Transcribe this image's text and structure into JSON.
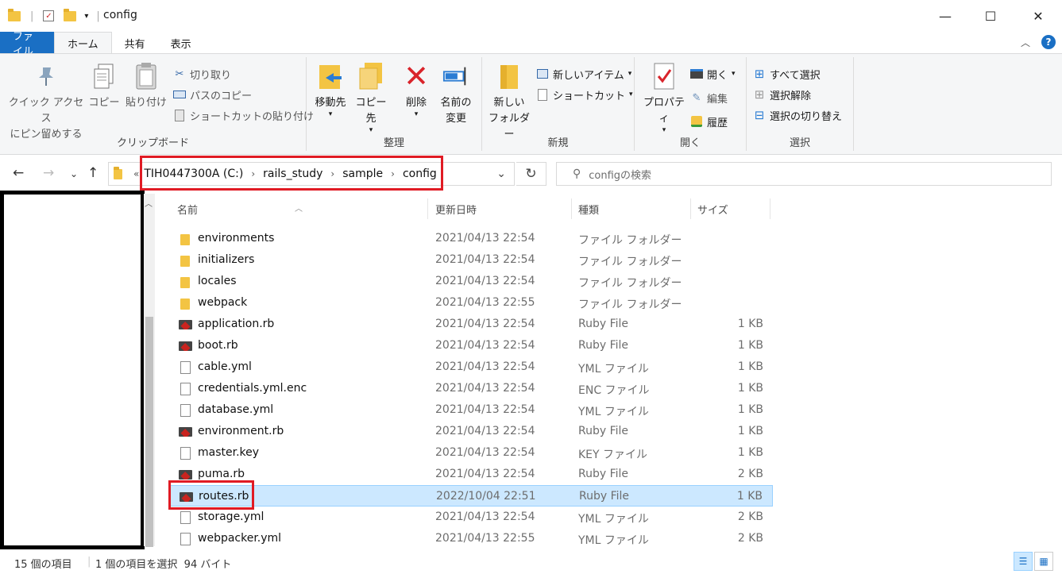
{
  "window": {
    "title": "config",
    "minimize": "—",
    "maximize": "☐",
    "close": "✕"
  },
  "tabs": {
    "file": "ファイル",
    "home": "ホーム",
    "share": "共有",
    "view": "表示"
  },
  "ribbon": {
    "clipboard": {
      "label": "クリップボード",
      "pin_quick_access": [
        "クイック アクセス",
        "にピン留めする"
      ],
      "copy": "コピー",
      "paste": "貼り付け",
      "cut": "切り取り",
      "copy_path": "パスのコピー",
      "paste_shortcut": "ショートカットの貼り付け"
    },
    "organize": {
      "label": "整理",
      "move_to": "移動先",
      "copy_to": "コピー先",
      "delete": "削除",
      "rename": [
        "名前の",
        "変更"
      ]
    },
    "new": {
      "label": "新規",
      "new_folder": [
        "新しい",
        "フォルダー"
      ],
      "new_item": "新しいアイテム",
      "shortcut": "ショートカット"
    },
    "open": {
      "label": "開く",
      "properties": "プロパティ",
      "open": "開く",
      "edit": "編集",
      "history": "履歴"
    },
    "select": {
      "label": "選択",
      "select_all": "すべて選択",
      "select_none": "選択解除",
      "invert": "選択の切り替え"
    }
  },
  "address": {
    "overflow": "«",
    "crumbs": [
      "TIH0447300A (C:)",
      "rails_study",
      "sample",
      "config"
    ],
    "search_placeholder": "configの検索"
  },
  "columns": {
    "name": "名前",
    "date": "更新日時",
    "type": "種類",
    "size": "サイズ"
  },
  "files": [
    {
      "name": "environments",
      "date": "2021/04/13 22:54",
      "type": "ファイル フォルダー",
      "size": "",
      "icon": "folder"
    },
    {
      "name": "initializers",
      "date": "2021/04/13 22:54",
      "type": "ファイル フォルダー",
      "size": "",
      "icon": "folder"
    },
    {
      "name": "locales",
      "date": "2021/04/13 22:54",
      "type": "ファイル フォルダー",
      "size": "",
      "icon": "folder"
    },
    {
      "name": "webpack",
      "date": "2021/04/13 22:55",
      "type": "ファイル フォルダー",
      "size": "",
      "icon": "folder"
    },
    {
      "name": "application.rb",
      "date": "2021/04/13 22:54",
      "type": "Ruby File",
      "size": "1 KB",
      "icon": "ruby"
    },
    {
      "name": "boot.rb",
      "date": "2021/04/13 22:54",
      "type": "Ruby File",
      "size": "1 KB",
      "icon": "ruby"
    },
    {
      "name": "cable.yml",
      "date": "2021/04/13 22:54",
      "type": "YML ファイル",
      "size": "1 KB",
      "icon": "file"
    },
    {
      "name": "credentials.yml.enc",
      "date": "2021/04/13 22:54",
      "type": "ENC ファイル",
      "size": "1 KB",
      "icon": "file"
    },
    {
      "name": "database.yml",
      "date": "2021/04/13 22:54",
      "type": "YML ファイル",
      "size": "1 KB",
      "icon": "file"
    },
    {
      "name": "environment.rb",
      "date": "2021/04/13 22:54",
      "type": "Ruby File",
      "size": "1 KB",
      "icon": "ruby"
    },
    {
      "name": "master.key",
      "date": "2021/04/13 22:54",
      "type": "KEY ファイル",
      "size": "1 KB",
      "icon": "file"
    },
    {
      "name": "puma.rb",
      "date": "2021/04/13 22:54",
      "type": "Ruby File",
      "size": "2 KB",
      "icon": "ruby"
    },
    {
      "name": "routes.rb",
      "date": "2022/10/04 22:51",
      "type": "Ruby File",
      "size": "1 KB",
      "icon": "ruby",
      "selected": true
    },
    {
      "name": "storage.yml",
      "date": "2021/04/13 22:54",
      "type": "YML ファイル",
      "size": "2 KB",
      "icon": "file"
    },
    {
      "name": "webpacker.yml",
      "date": "2021/04/13 22:55",
      "type": "YML ファイル",
      "size": "2 KB",
      "icon": "file"
    }
  ],
  "status": {
    "item_count": "15 個の項目",
    "selection": "1 個の項目を選択  94 バイト"
  },
  "colors": {
    "accent": "#1a6fc4",
    "selection": "#cce8ff",
    "highlight": "#e01b24"
  }
}
